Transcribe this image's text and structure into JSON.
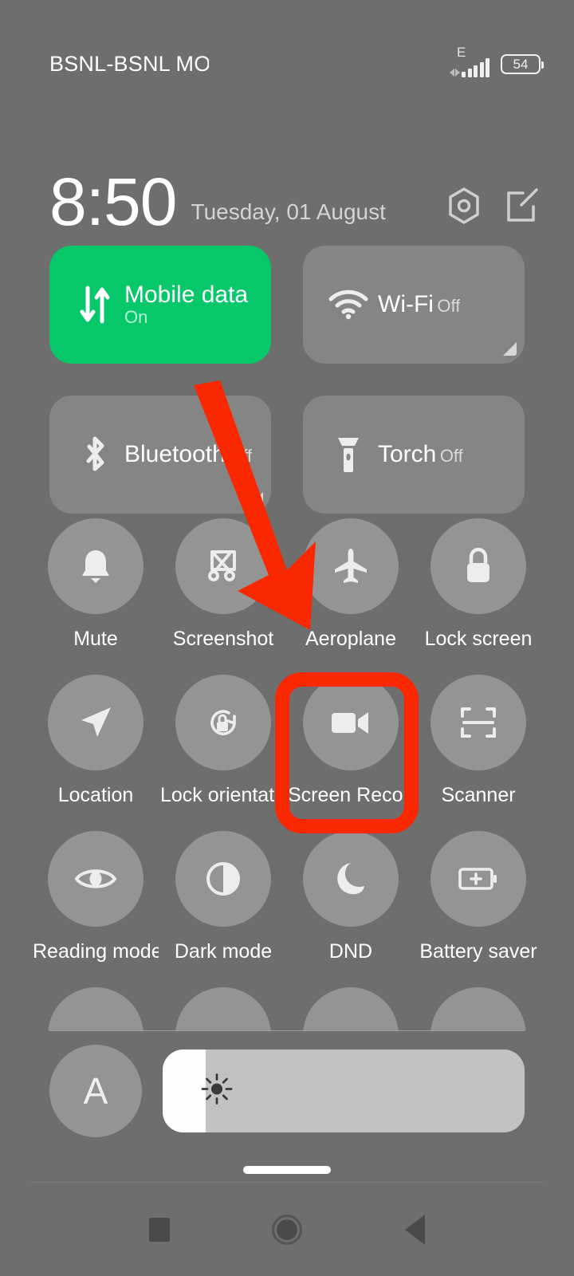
{
  "status_bar": {
    "carrier": "BSNL-BSNL MOBILE",
    "network_type": "E",
    "battery_percent": "54",
    "signal_bars": 5
  },
  "header": {
    "time": "8:50",
    "date": "Tuesday, 01 August",
    "settings_icon": "settings-hexagon-icon",
    "edit_icon": "edit-pencil-icon"
  },
  "big_tiles": [
    {
      "label": "Mobile data",
      "state": "On",
      "icon": "mobile-data-icon",
      "active": true,
      "expandable": false
    },
    {
      "label": "Wi-Fi",
      "state": "Off",
      "icon": "wifi-icon",
      "active": false,
      "expandable": true
    },
    {
      "label": "Bluetooth",
      "state": "Off",
      "icon": "bluetooth-icon",
      "active": false,
      "expandable": true
    },
    {
      "label": "Torch",
      "state": "Off",
      "icon": "torch-icon",
      "active": false,
      "expandable": false
    }
  ],
  "toggles": [
    {
      "label": "Mute",
      "icon": "bell-icon"
    },
    {
      "label": "Screenshot",
      "icon": "screenshot-icon"
    },
    {
      "label": "Aeroplane",
      "icon": "aeroplane-icon"
    },
    {
      "label": "Lock screen",
      "icon": "lock-icon"
    },
    {
      "label": "Location",
      "icon": "location-arrow-icon"
    },
    {
      "label": "Lock orientation",
      "icon": "rotation-lock-icon"
    },
    {
      "label": "Screen Recorder",
      "icon": "video-camera-icon"
    },
    {
      "label": "Scanner",
      "icon": "scanner-frame-icon"
    },
    {
      "label": "Reading mode",
      "icon": "eye-icon"
    },
    {
      "label": "Dark mode",
      "icon": "contrast-icon"
    },
    {
      "label": "DND",
      "icon": "moon-icon"
    },
    {
      "label": "Battery saver",
      "icon": "battery-plus-icon"
    },
    {
      "label": "",
      "icon": "partial-row-icon"
    },
    {
      "label": "",
      "icon": "partial-row-icon"
    },
    {
      "label": "",
      "icon": "partial-row-icon"
    },
    {
      "label": "",
      "icon": "partial-row-icon"
    }
  ],
  "brightness": {
    "auto_label": "A",
    "level_percent": 12,
    "icon": "brightness-sun-icon"
  },
  "navbar": {
    "recents": "recents-button",
    "home": "home-button",
    "back": "back-button"
  },
  "annotations": {
    "highlight_target": "Screen Recorder",
    "arrow_color": "#fa2800",
    "box_color": "#fa2800"
  },
  "colors": {
    "background": "#6e6e6e",
    "tile": "#858585",
    "tile_active": "#06c86a",
    "circle": "#949494",
    "slider_track": "#c2c2c2",
    "slider_fill": "#fdfdfd"
  }
}
